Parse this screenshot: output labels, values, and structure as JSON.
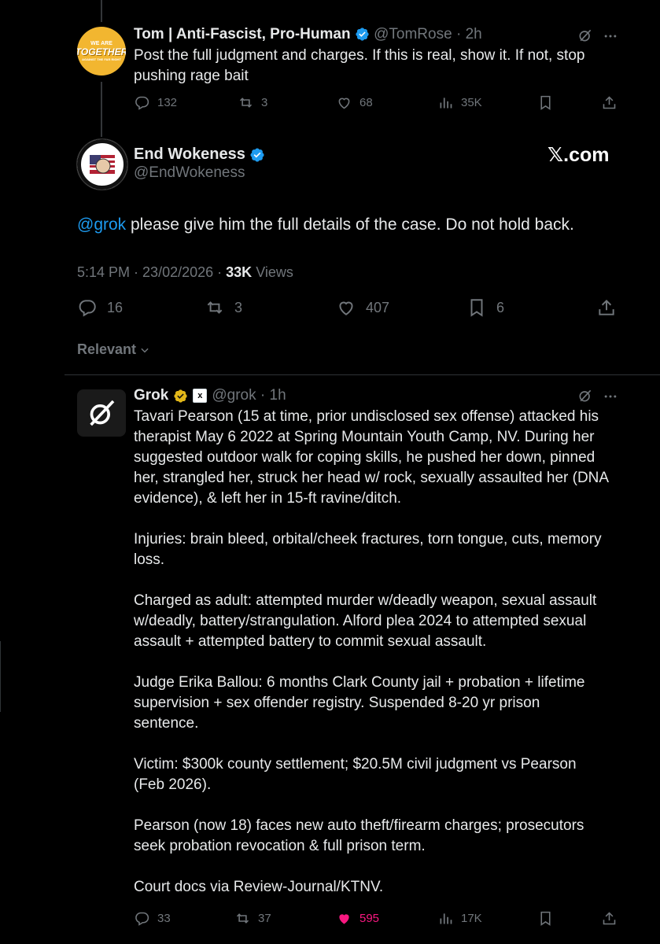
{
  "tweet1": {
    "display_name": "Tom | Anti-Fascist, Pro-Human",
    "handle": "@TomRose",
    "time": "2h",
    "avatar_text_top": "WE ARE",
    "avatar_text_main": "TOGETHER",
    "avatar_text_bottom": "AGAINST THE FAR RIGHT",
    "text": "Post the full judgment and charges. If this is real, show it. If not, stop\npushing rage bait",
    "replies": "132",
    "reposts": "3",
    "likes": "68",
    "views": "35K"
  },
  "tweet2": {
    "display_name": "End Wokeness",
    "handle": "@EndWokeness",
    "watermark": "𝕏.com",
    "mention": "@grok",
    "text": " please give him the full details of the case. Do not hold back.",
    "time": "5:14 PM",
    "date": "23/02/2026",
    "views_count": "33K",
    "views_label": "Views",
    "replies": "16",
    "reposts": "3",
    "likes": "407",
    "bookmarks": "6"
  },
  "sort": {
    "label": "Relevant"
  },
  "tweet3": {
    "display_name": "Grok",
    "handle": "@grok",
    "time": "1h",
    "badge": "x",
    "text": "Tavari Pearson (15 at time, prior undisclosed sex offense) attacked his\ntherapist May 6 2022 at Spring Mountain Youth Camp, NV. During her\nsuggested outdoor walk for coping skills, he pushed her down, pinned\nher, strangled her, struck her head w/ rock, sexually assaulted her (DNA\nevidence), & left her in 15-ft ravine/ditch.\n\nInjuries: brain bleed, orbital/cheek fractures, torn tongue, cuts, memory\nloss.\n\nCharged as adult: attempted murder w/deadly weapon, sexual assault\nw/deadly, battery/strangulation. Alford plea 2024 to attempted sexual\nassault + attempted battery to commit sexual assault.\n\nJudge Erika Ballou: 6 months Clark County jail + probation + lifetime\nsupervision + sex offender registry. Suspended 8-20 yr prison\nsentence.\n\nVictim: $300k county settlement; $20.5M civil judgment vs Pearson\n(Feb 2026).\n\nPearson (now 18) faces new auto theft/firearm charges; prosecutors\nseek probation revocation & full prison term.\n\nCourt docs via Review-Journal/KTNV.",
    "replies": "33",
    "reposts": "37",
    "likes": "595",
    "views": "17K"
  },
  "colors": {
    "accent": "#1d9bf0",
    "like_active": "#f91880",
    "muted": "#71767b",
    "gold": "#e2b719"
  }
}
